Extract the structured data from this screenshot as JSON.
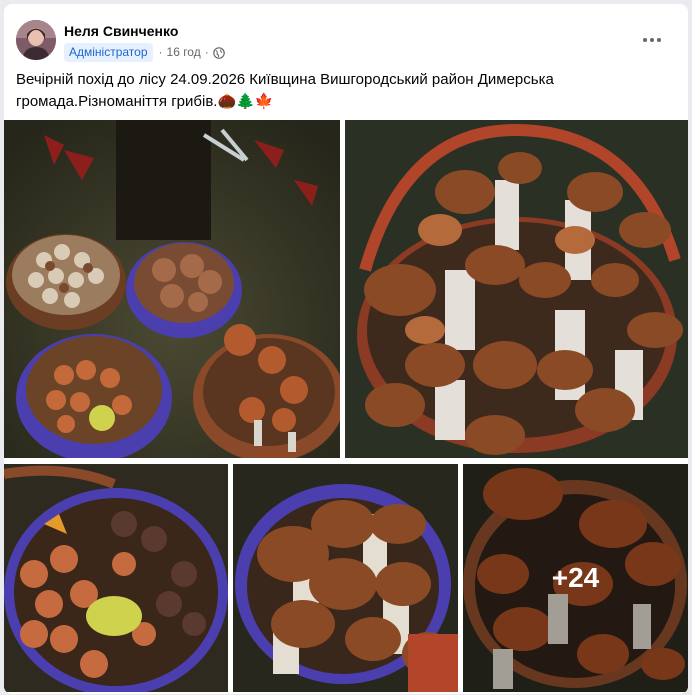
{
  "post": {
    "author": "Неля Свинченко",
    "badge": "Адміністратор",
    "time": "16 год",
    "privacy_icon": "globe-icon",
    "menu_icon": "more-options-icon",
    "text": "Вечірній похід до лісу 24.09.2026 Київщина Вишгородський район Димерська громада.Різноманіття грибів.🌰🌲🍁"
  },
  "gallery": {
    "photos": [
      {
        "name": "photo-baskets-overview"
      },
      {
        "name": "photo-porcini-basket"
      },
      {
        "name": "photo-mixed-mushrooms-blue-basket"
      },
      {
        "name": "photo-porcini-blue-basket"
      },
      {
        "name": "photo-more-mushrooms"
      }
    ],
    "more_count": "+24"
  },
  "colors": {
    "badge_bg": "#e7f0fe",
    "badge_text": "#1b66d2",
    "basket_blue": "#4b3fb0",
    "basket_wicker": "#8a4a2a",
    "cap_brown": "#7a3a1c"
  }
}
